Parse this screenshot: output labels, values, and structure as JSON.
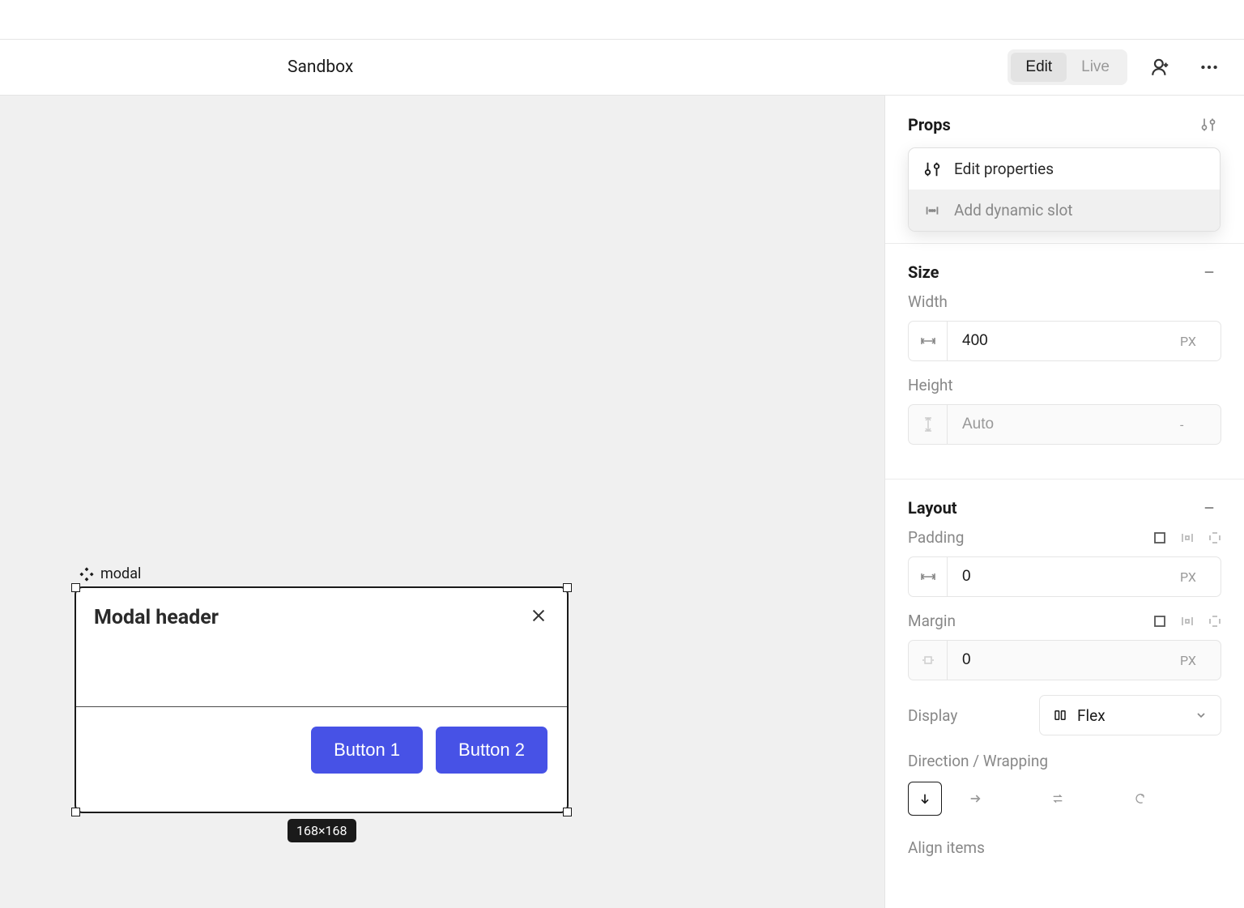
{
  "header": {
    "title": "Sandbox",
    "modes": {
      "edit": "Edit",
      "live": "Live"
    }
  },
  "canvas": {
    "component_name": "modal",
    "modal": {
      "title": "Modal header",
      "button1": "Button 1",
      "button2": "Button 2"
    },
    "size_badge": "168×168"
  },
  "sidebar": {
    "props": {
      "title": "Props",
      "menu": {
        "edit_properties": "Edit properties",
        "add_dynamic_slot": "Add dynamic slot"
      }
    },
    "size": {
      "title": "Size",
      "width_label": "Width",
      "width_value": "400",
      "width_unit": "PX",
      "height_label": "Height",
      "height_placeholder": "Auto",
      "height_unit": "-"
    },
    "layout": {
      "title": "Layout",
      "padding_label": "Padding",
      "padding_value": "0",
      "padding_unit": "PX",
      "margin_label": "Margin",
      "margin_value": "0",
      "margin_unit": "PX",
      "display_label": "Display",
      "display_value": "Flex",
      "direction_label": "Direction / Wrapping",
      "align_label": "Align items"
    }
  }
}
